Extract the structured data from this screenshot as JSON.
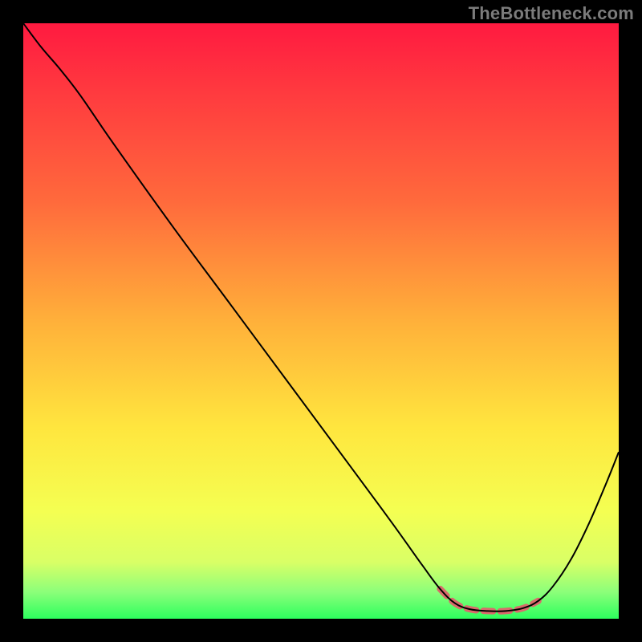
{
  "watermark": "TheBottleneck.com",
  "chart_data": {
    "type": "line",
    "title": "",
    "xlabel": "",
    "ylabel": "",
    "xlim": [
      0,
      100
    ],
    "ylim": [
      0,
      100
    ],
    "gradient_stops": [
      {
        "offset": 0.0,
        "color": "#ff1a40"
      },
      {
        "offset": 0.12,
        "color": "#ff3b3f"
      },
      {
        "offset": 0.3,
        "color": "#ff6a3c"
      },
      {
        "offset": 0.5,
        "color": "#ffb03a"
      },
      {
        "offset": 0.68,
        "color": "#ffe63e"
      },
      {
        "offset": 0.82,
        "color": "#f4ff52"
      },
      {
        "offset": 0.905,
        "color": "#d9ff66"
      },
      {
        "offset": 0.955,
        "color": "#8cff7a"
      },
      {
        "offset": 1.0,
        "color": "#2dff5e"
      }
    ],
    "series": [
      {
        "name": "bottleneck-curve",
        "color": "#000000",
        "width": 2,
        "points": [
          {
            "x": 0.0,
            "y": 100.0
          },
          {
            "x": 3.0,
            "y": 96.0
          },
          {
            "x": 6.0,
            "y": 92.5
          },
          {
            "x": 9.5,
            "y": 88.0
          },
          {
            "x": 15.0,
            "y": 80.0
          },
          {
            "x": 25.0,
            "y": 66.0
          },
          {
            "x": 35.0,
            "y": 52.5
          },
          {
            "x": 45.0,
            "y": 39.0
          },
          {
            "x": 55.0,
            "y": 25.5
          },
          {
            "x": 62.0,
            "y": 16.0
          },
          {
            "x": 67.0,
            "y": 9.0
          },
          {
            "x": 70.0,
            "y": 5.0
          },
          {
            "x": 72.5,
            "y": 2.6
          },
          {
            "x": 75.0,
            "y": 1.6
          },
          {
            "x": 78.0,
            "y": 1.3
          },
          {
            "x": 81.0,
            "y": 1.3
          },
          {
            "x": 84.0,
            "y": 1.8
          },
          {
            "x": 86.5,
            "y": 3.0
          },
          {
            "x": 89.0,
            "y": 5.5
          },
          {
            "x": 92.0,
            "y": 10.0
          },
          {
            "x": 95.0,
            "y": 16.0
          },
          {
            "x": 98.0,
            "y": 23.0
          },
          {
            "x": 100.0,
            "y": 28.0
          }
        ]
      },
      {
        "name": "optimal-band",
        "color": "#d96b6b",
        "width": 8,
        "dash": [
          12,
          9
        ],
        "points": [
          {
            "x": 70.0,
            "y": 5.0
          },
          {
            "x": 72.5,
            "y": 2.6
          },
          {
            "x": 75.0,
            "y": 1.6
          },
          {
            "x": 78.0,
            "y": 1.3
          },
          {
            "x": 81.0,
            "y": 1.3
          },
          {
            "x": 84.0,
            "y": 1.8
          },
          {
            "x": 86.5,
            "y": 3.0
          }
        ]
      }
    ]
  }
}
